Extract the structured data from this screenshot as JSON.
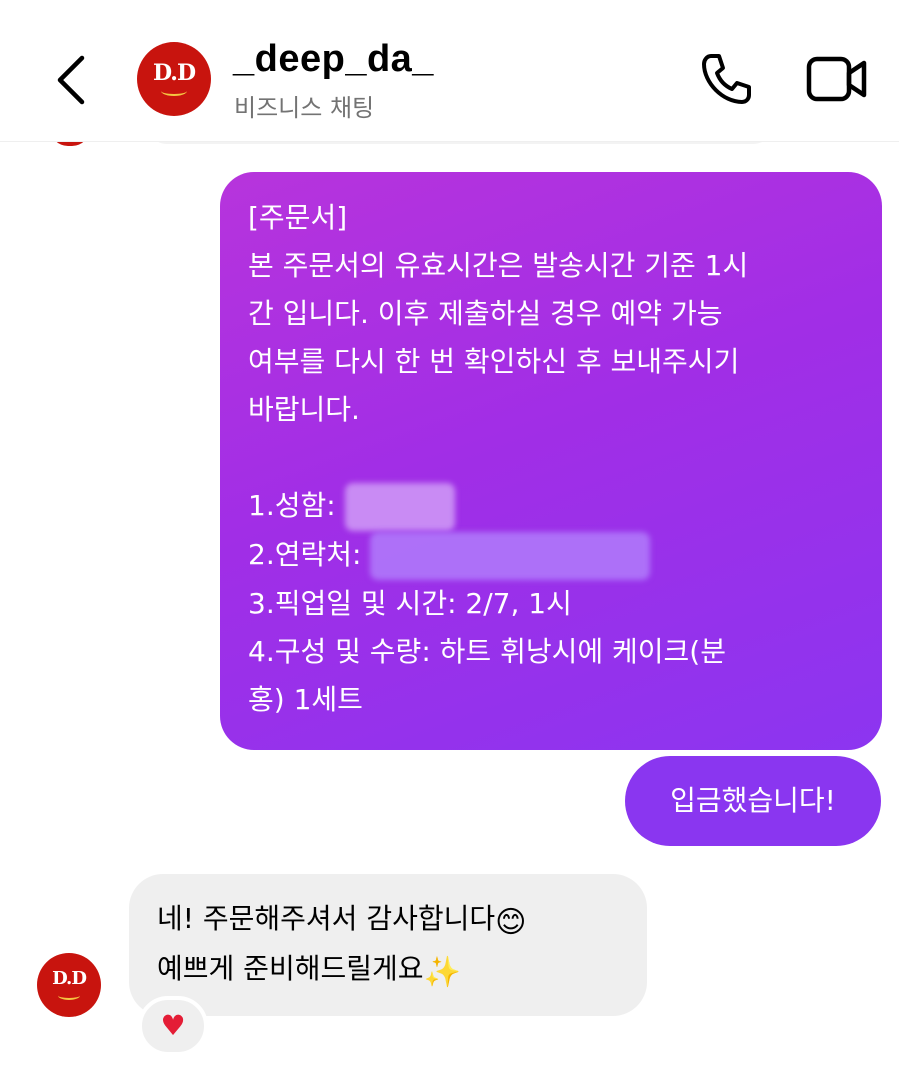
{
  "header": {
    "username": "_deep_da_",
    "subtitle": "비즈니스 채팅",
    "avatar_text": "D.D",
    "icons": {
      "back": "chevron-left-icon",
      "call": "phone-icon",
      "video": "video-camera-icon"
    }
  },
  "messages": {
    "order": {
      "lines": [
        "[주문서]",
        "본 주문서의 유효시간은 발송시간 기준 1시",
        "간 입니다. 이후 제출하실 경우 예약 가능",
        "여부를 다시 한 번 확인하신 후 보내주시기",
        "바랍니다.",
        "",
        "1.성함:",
        "2.연락처:",
        "3.픽업일 및 시간: 2/7, 1시",
        "4.구성 및 수량: 하트 휘낭시에 케이크(분",
        "홍) 1세트"
      ]
    },
    "deposit": {
      "text": "입금했습니다!"
    },
    "reply": {
      "line1": "네! 주문해주셔서 감사합니다",
      "line2": "예쁘게 준비해드릴게요",
      "emoji1": "😊",
      "emoji2": "✨",
      "reaction": "♥"
    }
  },
  "colors": {
    "bubble_gradient_start": "#b734dc",
    "bubble_gradient_end": "#8c35f0",
    "sent_bubble": "#8a36f0",
    "received_bubble": "#efefef",
    "avatar_red": "#c8140e",
    "heart": "#e41d36"
  }
}
